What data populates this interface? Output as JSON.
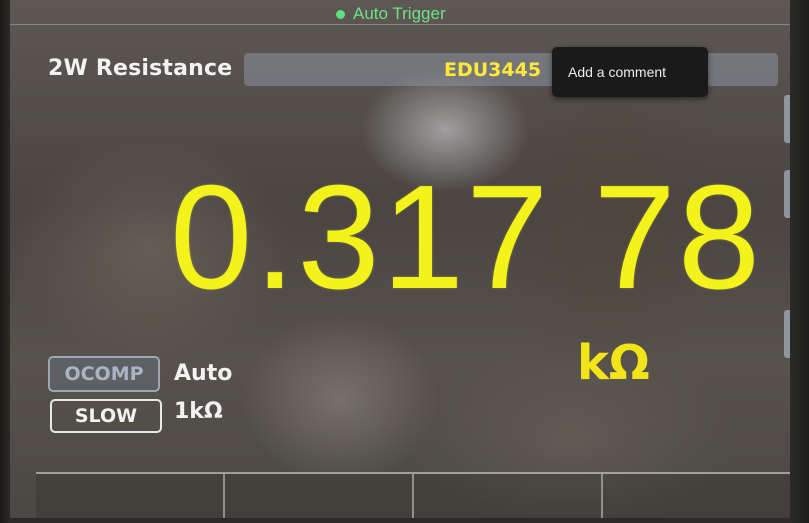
{
  "status": {
    "trigger_label": "Auto Trigger",
    "trigger_color": "#6fe089"
  },
  "header": {
    "function_title": "2W Resistance",
    "model_name": "EDU3445"
  },
  "measurement": {
    "reading": "0.317 78",
    "unit": "kΩ",
    "reading_color": "#f3f21a"
  },
  "settings": [
    {
      "label": "OCOMP",
      "value": "Auto",
      "state": "inactive"
    },
    {
      "label": "SLOW",
      "value": "1kΩ",
      "state": "active"
    }
  ],
  "softkeys": [
    "",
    "",
    "",
    ""
  ],
  "tooltip": {
    "text": "Add a comment"
  }
}
